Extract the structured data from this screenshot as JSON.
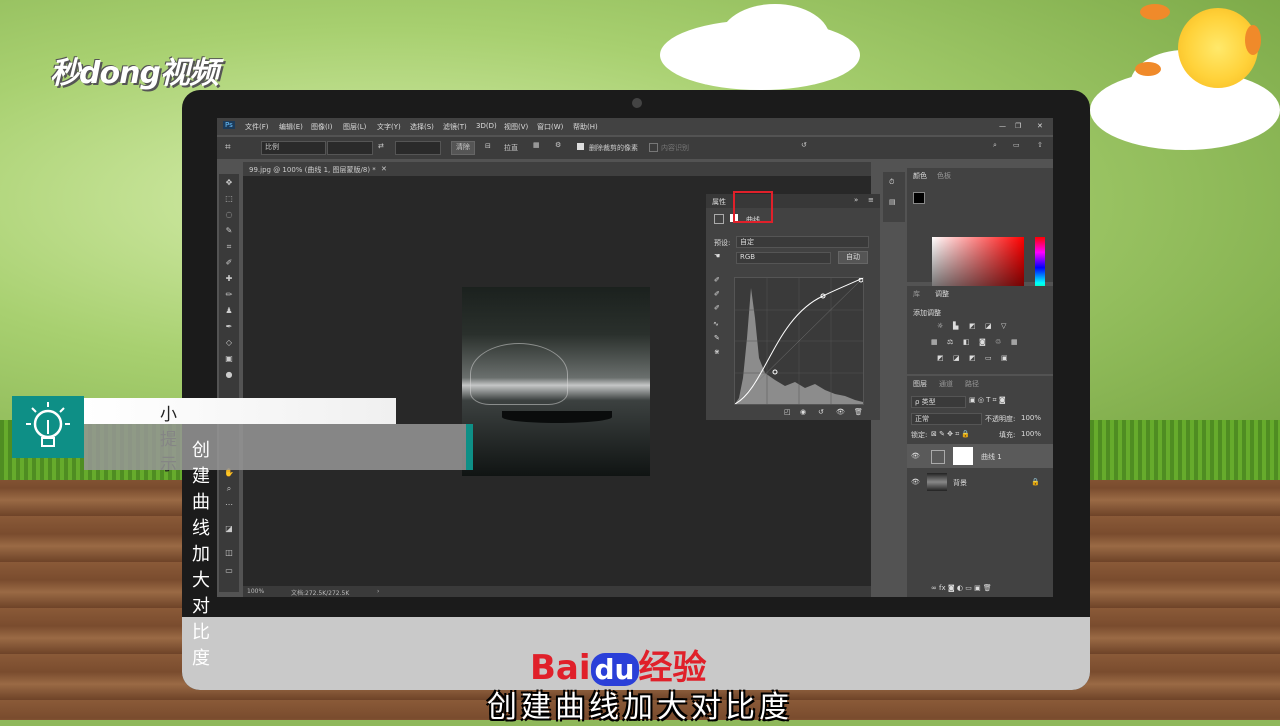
{
  "overlay": {
    "logo_text": "秒dong视频",
    "tip_title": "小提示",
    "tip_text": "创建曲线加大对比度",
    "subtitle": "创建曲线加大对比度",
    "brand": {
      "bai": "Bai",
      "du": "du",
      "jingyan": "经验"
    }
  },
  "ps": {
    "app_icon": "Ps",
    "menu": [
      "文件(F)",
      "编辑(E)",
      "图像(I)",
      "图层(L)",
      "文字(Y)",
      "选择(S)",
      "滤镜(T)",
      "3D(D)",
      "视图(V)",
      "窗口(W)",
      "帮助(H)"
    ],
    "options": {
      "ratio_select": "比例",
      "clear_button": "清除",
      "straighten_button": "拉直",
      "delete_cropped_label": "删除裁剪的像素",
      "content_aware_label": "内容识别"
    },
    "doc_tab": "99.jpg @ 100% (曲线 1, 图层蒙版/8) *",
    "status": {
      "zoom": "100%",
      "doc": "文档:272.5K/272.5K"
    },
    "properties": {
      "tab": "属性",
      "title": "曲线",
      "preset_label": "预设:",
      "preset_value": "自定",
      "channel": "RGB",
      "auto_button": "自动"
    },
    "color_panel": {
      "tabs": [
        "颜色",
        "色板"
      ]
    },
    "adjust_panel": {
      "tabs": [
        "库",
        "调整"
      ],
      "add_label": "添加调整"
    },
    "layers_panel": {
      "tabs": [
        "图层",
        "通道",
        "路径"
      ],
      "kind_filter": "ρ 类型",
      "blend_mode": "正常",
      "opacity_label": "不透明度:",
      "opacity_value": "100%",
      "lock_label": "锁定:",
      "fill_label": "填充:",
      "fill_value": "100%",
      "layers": [
        {
          "name": "曲线 1"
        },
        {
          "name": "背景"
        }
      ]
    }
  },
  "colors": {
    "accent_teal": "#0e8f86",
    "highlight_red": "#e0202a"
  }
}
